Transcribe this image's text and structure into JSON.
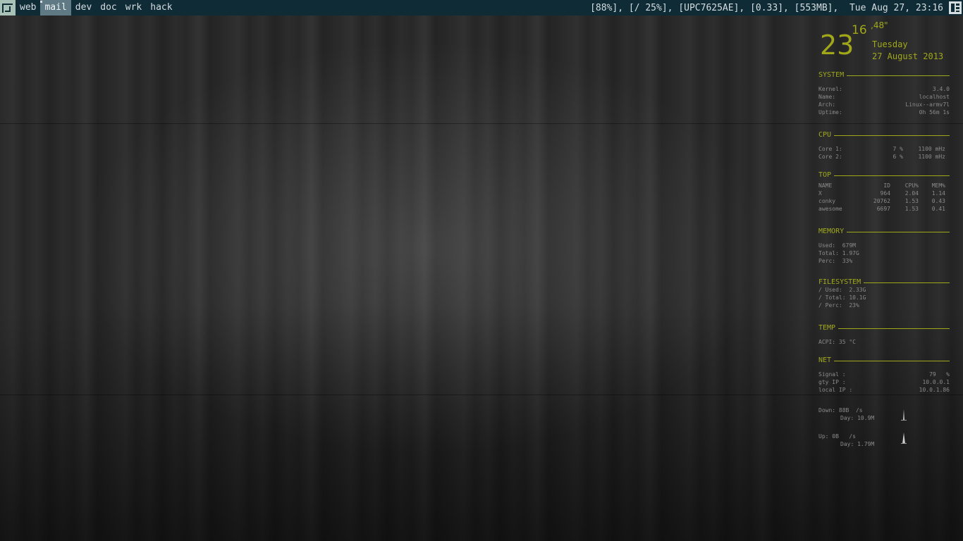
{
  "bar": {
    "tags": [
      "web",
      "mail",
      "dev",
      "doc",
      "wrk",
      "hack"
    ],
    "active_tag": "mail",
    "status": "[88%], [/ 25%], [UPC7625AE], [0.33], [553MB],  Tue Aug 27, 23:16",
    "launcher_icon": "awesome-icon",
    "layout_icon": "tile-layout-icon"
  },
  "conky": {
    "clock": {
      "hours": "23",
      "minutes": "16",
      "seconds": ",48\"",
      "weekday": "Tuesday",
      "date": "27 August 2013"
    },
    "system": {
      "title": "SYSTEM",
      "rows": [
        {
          "k": "Kernel:",
          "v": "3.4.0"
        },
        {
          "k": "Name:",
          "v": "localhost"
        },
        {
          "k": "Arch:",
          "v": "Linux--armv7l"
        },
        {
          "k": "Uptime:",
          "v": "0h 56m 1s"
        }
      ]
    },
    "cpu": {
      "title": "CPU",
      "rows": [
        {
          "core": "Core 1:",
          "pct": "7 %",
          "freq": "1100 mHz"
        },
        {
          "core": "Core 2:",
          "pct": "6 %",
          "freq": "1100 mHz"
        }
      ]
    },
    "top": {
      "title": "TOP",
      "headers": [
        "NAME",
        "ID",
        "CPU%",
        "MEM%"
      ],
      "rows": [
        [
          "X",
          "964",
          "2.04",
          "1.14"
        ],
        [
          "conky",
          "20762",
          "1.53",
          "0.43"
        ],
        [
          "awesome",
          "6697",
          "1.53",
          "0.41"
        ]
      ]
    },
    "memory": {
      "title": "MEMORY",
      "rows": [
        "Used:  679M",
        "Total: 1.97G",
        "Perc:  33%"
      ]
    },
    "filesystem": {
      "title": "FILESYSTEM",
      "rows": [
        "/ Used:  2.33G",
        "/ Total: 10.1G",
        "/ Perc:  23%"
      ]
    },
    "temp": {
      "title": "TEMP",
      "rows": [
        "ACPI: 35 °C"
      ]
    },
    "net": {
      "title": "NET",
      "rows": [
        {
          "k": "Signal :",
          "v": "79   %"
        },
        {
          "k": "gty IP :",
          "v": "10.0.0.1"
        },
        {
          "k": "local IP :",
          "v": "10.0.1.86"
        }
      ],
      "down": {
        "rate": "Down: 88B  /s",
        "day": "Day: 10.9M"
      },
      "up": {
        "rate": "Up: 0B   /s",
        "day": "Day: 1.79M"
      }
    },
    "accent_color": "#a0a81a"
  }
}
